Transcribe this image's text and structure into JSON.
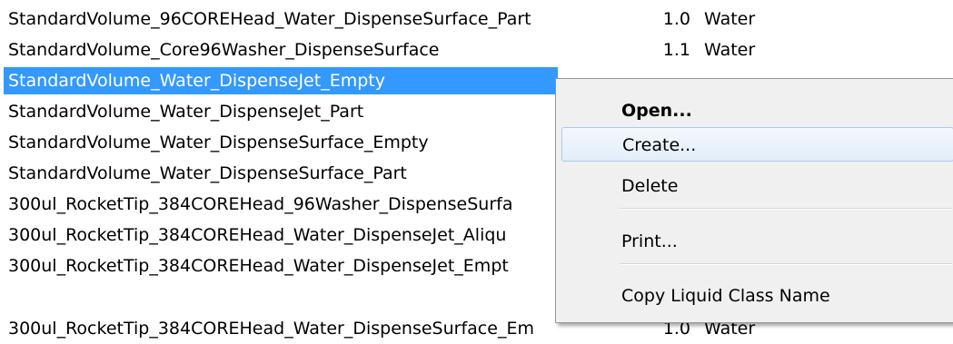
{
  "rows": [
    {
      "name": "StandardVolume_96COREHead_Water_DispenseSurface_Part",
      "version": "1.0",
      "liquid": "Water"
    },
    {
      "name": "StandardVolume_Core96Washer_DispenseSurface",
      "version": "1.1",
      "liquid": "Water"
    },
    {
      "name": "StandardVolume_Water_DispenseJet_Empty",
      "version": "",
      "liquid": ""
    },
    {
      "name": "StandardVolume_Water_DispenseJet_Part",
      "version": "",
      "liquid": ""
    },
    {
      "name": "StandardVolume_Water_DispenseSurface_Empty",
      "version": "",
      "liquid": ""
    },
    {
      "name": "StandardVolume_Water_DispenseSurface_Part",
      "version": "",
      "liquid": ""
    },
    {
      "name": "300ul_RocketTip_384COREHead_96Washer_DispenseSurfa",
      "version": "",
      "liquid": ""
    },
    {
      "name": "300ul_RocketTip_384COREHead_Water_DispenseJet_Aliqu",
      "version": "",
      "liquid": ""
    },
    {
      "name": "300ul_RocketTip_384COREHead_Water_DispenseJet_Empt",
      "version": "",
      "liquid": ""
    },
    {
      "name": "300ul_RocketTip_384COREHead_Water_DispenseSurface_Em",
      "version": "1.0",
      "liquid": "Water"
    }
  ],
  "selected_row_index": 2,
  "context_menu": {
    "items": {
      "open": "Open...",
      "create": "Create...",
      "delete": "Delete",
      "print": "Print...",
      "copy_name": "Copy Liquid Class Name"
    },
    "hovered_item": "create"
  }
}
